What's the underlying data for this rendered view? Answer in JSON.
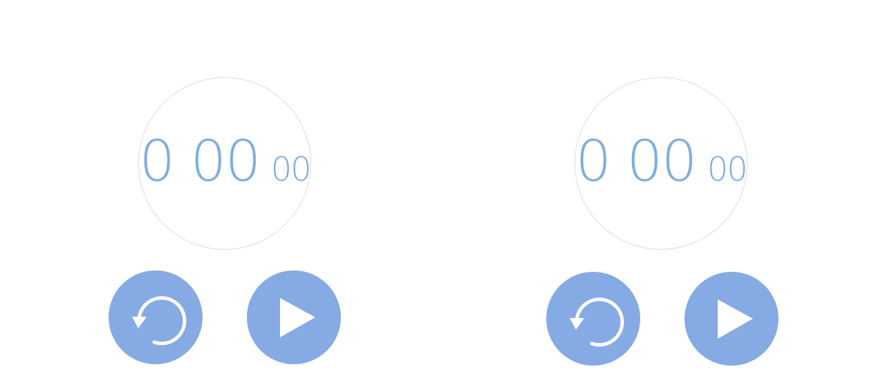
{
  "timers": [
    {
      "display": {
        "minutes": "0",
        "seconds": "00",
        "hundredths": "00"
      },
      "buttons": {
        "reset_icon": "reset-icon",
        "play_icon": "play-icon"
      }
    },
    {
      "display": {
        "minutes": "0",
        "seconds": "00",
        "hundredths": "00"
      },
      "buttons": {
        "reset_icon": "reset-icon",
        "play_icon": "play-icon"
      }
    }
  ],
  "colors": {
    "digits": "#7eaee0",
    "button_fill": "#86aae3",
    "dial_border": "#dcdcdc",
    "icon": "#ffffff"
  }
}
